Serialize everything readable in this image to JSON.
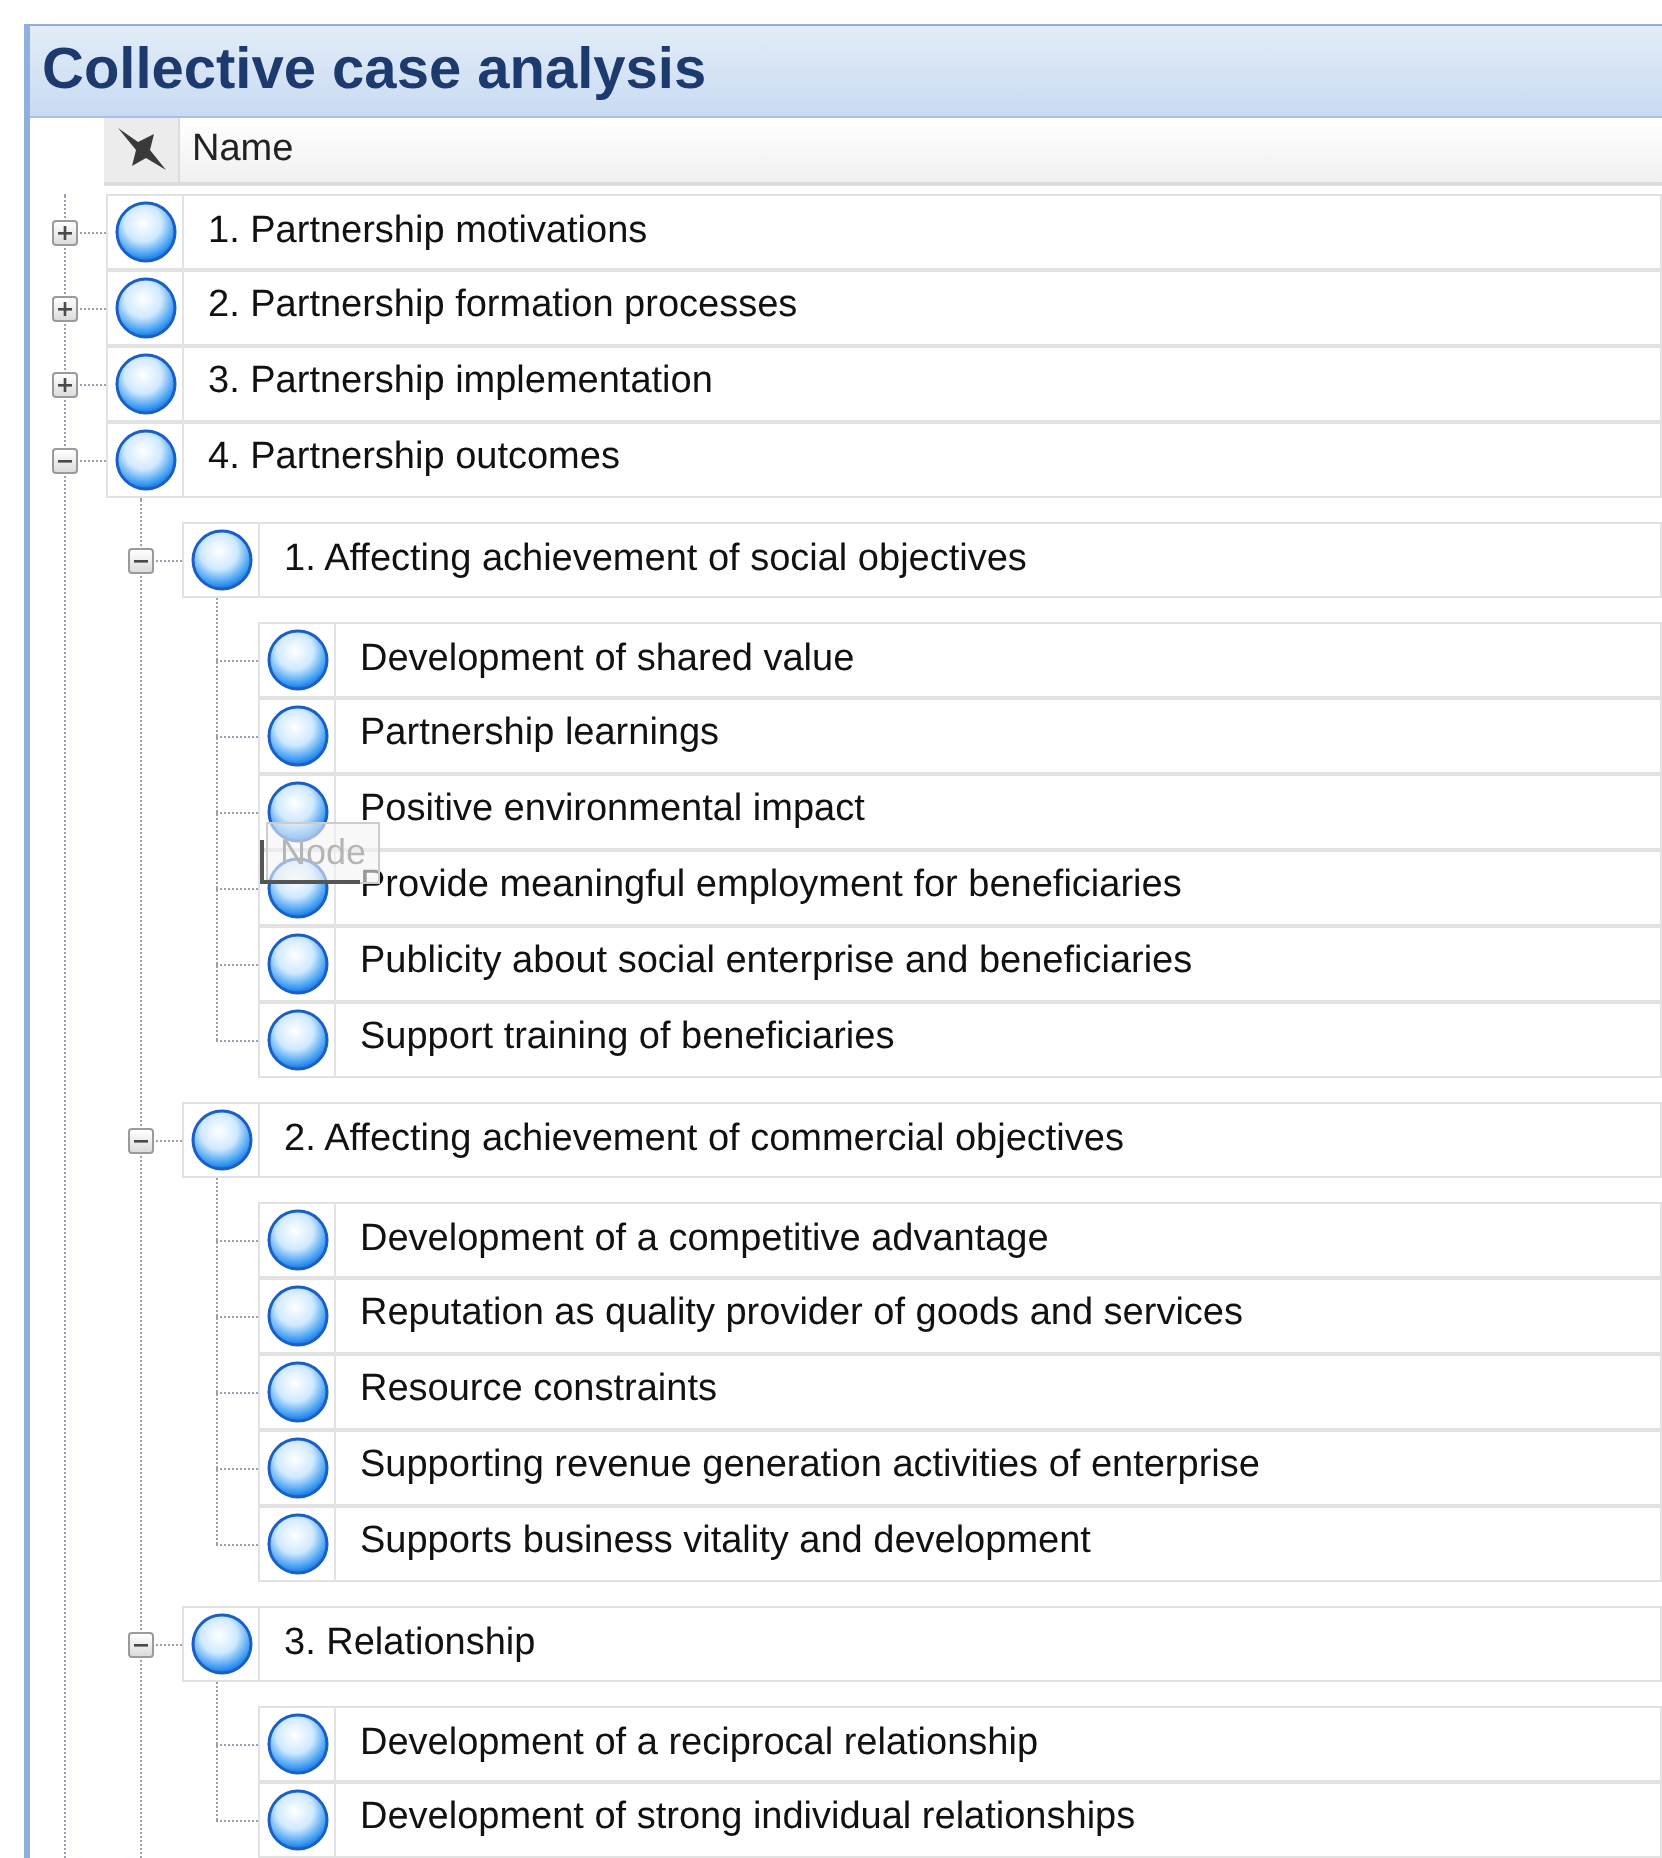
{
  "title": "Collective case analysis",
  "header": {
    "label": "Name"
  },
  "nodes": [
    {
      "label": "1. Partnership motivations",
      "expanded": false
    },
    {
      "label": "2. Partnership formation processes",
      "expanded": false
    },
    {
      "label": "3. Partnership implementation",
      "expanded": false
    },
    {
      "label": "4. Partnership outcomes",
      "expanded": true,
      "children": [
        {
          "label": "1. Affecting achievement of social objectives",
          "expanded": true,
          "children": [
            {
              "label": "Development of shared value"
            },
            {
              "label": "Partnership learnings"
            },
            {
              "label": "Positive environmental impact"
            },
            {
              "label": "Provide meaningful employment for beneficiaries"
            },
            {
              "label": "Publicity about social enterprise and beneficiaries"
            },
            {
              "label": "Support training of beneficiaries"
            }
          ]
        },
        {
          "label": "2. Affecting achievement of commercial objectives",
          "expanded": true,
          "children": [
            {
              "label": "Development of a competitive advantage"
            },
            {
              "label": "Reputation as quality provider of goods and services"
            },
            {
              "label": "Resource constraints"
            },
            {
              "label": "Supporting revenue generation activities of enterprise"
            },
            {
              "label": "Supports business vitality and development"
            }
          ]
        },
        {
          "label": "3. Relationship",
          "expanded": true,
          "children": [
            {
              "label": "Development of a reciprocal relationship"
            },
            {
              "label": "Development of strong individual relationships"
            }
          ]
        }
      ]
    }
  ],
  "drag_ghost": {
    "label": "Node"
  }
}
